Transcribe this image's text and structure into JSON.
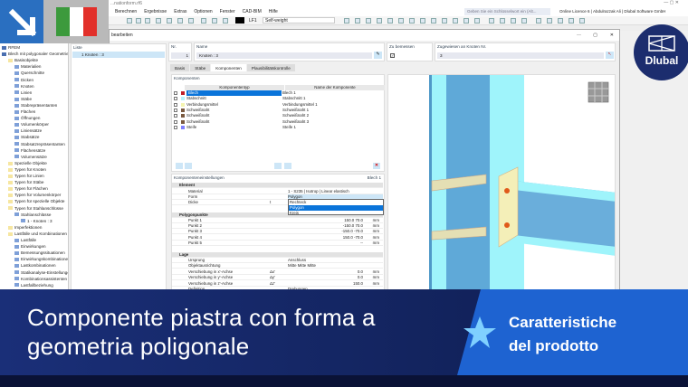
{
  "app": {
    "title_partial": "...nationform.rf6",
    "menu": [
      "Berechnen",
      "Ergebnisse",
      "Extras",
      "Optionen",
      "Fenster",
      "CAD-BIM",
      "Hilfe"
    ],
    "load_case": "LF1",
    "load_case_name": "Self-weight",
    "search_placeholder": "Geben Sie ein Schlüsselwort ein (Alt...",
    "license": "Online Licence 6 | Abdulrazzak Ali | Dlubal Software GmbH"
  },
  "dialog": {
    "title_partial": "bearbeiten",
    "liste_label": "Liste",
    "liste_item": "1  Knoten : 3",
    "nr_label": "Nr.",
    "nr_value": "1",
    "name_label": "Name",
    "name_value": "Knoten : 3",
    "design_label": "Zu bemessen",
    "assigned_label": "Zugewiesen an Knoten Nr.",
    "assigned_value": "3",
    "tabs": [
      "Basis",
      "Stäbe",
      "Komponenten",
      "Plausibilitätskontrolle"
    ],
    "components_title": "Komponenten",
    "col_type": "Komponententyp",
    "col_name": "Name der Komponente",
    "components": [
      {
        "type": "Blech",
        "name": "Blech 1",
        "color": "#c0202a"
      },
      {
        "type": "Stabschnitt",
        "name": "Stabschnitt 1",
        "color": "#b8f4ff"
      },
      {
        "type": "Verbindungsmittel",
        "name": "Verbindungsmittel 1",
        "color": "#f4f4b0"
      },
      {
        "type": "Schweißnaht",
        "name": "Schweißnaht 1",
        "color": "#7a5a40"
      },
      {
        "type": "Schweißnaht",
        "name": "Schweißnaht 2",
        "color": "#7a5a40"
      },
      {
        "type": "Schweißnaht",
        "name": "Schweißnaht 3",
        "color": "#7a5a40"
      },
      {
        "type": "Steife",
        "name": "Steife 1",
        "color": "#8080ff"
      }
    ],
    "settings_title": "Komponenteneinstellungen",
    "settings_target": "Blech 1",
    "settings": [
      {
        "k": "Element",
        "hdr": true
      },
      {
        "k": "Material",
        "v": "1 - S235 | Isotrop | Linear elastisch"
      },
      {
        "k": "Form",
        "v": "Polygon"
      },
      {
        "k": "Dicke",
        "s": "t"
      },
      {
        "k": "Polygonpunkte",
        "hdr": true
      },
      {
        "k": "Punkt 1",
        "vr": "150.0 70.0",
        "u": "mm"
      },
      {
        "k": "Punkt 2",
        "vr": "-150.0 70.0",
        "u": "mm"
      },
      {
        "k": "Punkt 3",
        "vr": "-150.0 -70.0",
        "u": "mm"
      },
      {
        "k": "Punkt 4",
        "vr": "150.0 -70.0",
        "u": "mm"
      },
      {
        "k": "Punkt 5",
        "vr": "--",
        "u": "mm"
      },
      {
        "k": "Lage",
        "hdr": true
      },
      {
        "k": "Ursprung",
        "v": "Anschluss"
      },
      {
        "k": "Objektausrichtung",
        "v": "Mitte      Mitte      Mitte"
      },
      {
        "k": "Verschiebung in x'-Achse",
        "s": "Δx'",
        "vr": "0.0",
        "u": "mm"
      },
      {
        "k": "Verschiebung in y'-Achse",
        "s": "Δy'",
        "vr": "0.0",
        "u": "mm"
      },
      {
        "k": "Verschiebung in z'-Achse",
        "s": "Δz'",
        "vr": "150.0",
        "u": "mm"
      },
      {
        "k": "Definition",
        "v": "Drehungen"
      }
    ],
    "form_options": [
      "Rechteck",
      "Polygon",
      "Kreis"
    ],
    "form_selected": "Polygon"
  },
  "navigator": [
    {
      "t": "RFEM",
      "l": 0
    },
    {
      "t": "Blech mit polygonaler Geometrie",
      "l": 0
    },
    {
      "t": "Basisobjekte",
      "l": 1,
      "f": 1
    },
    {
      "t": "Materialien",
      "l": 2
    },
    {
      "t": "Querschnitte",
      "l": 2
    },
    {
      "t": "Dicken",
      "l": 2
    },
    {
      "t": "Knoten",
      "l": 2
    },
    {
      "t": "Linien",
      "l": 2
    },
    {
      "t": "Stäbe",
      "l": 2
    },
    {
      "t": "Stabrepräsentanten",
      "l": 2
    },
    {
      "t": "Flächen",
      "l": 2
    },
    {
      "t": "Öffnungen",
      "l": 2
    },
    {
      "t": "Volumenkörper",
      "l": 2
    },
    {
      "t": "Liniensätze",
      "l": 2
    },
    {
      "t": "Stabsätze",
      "l": 2
    },
    {
      "t": "Stabsatzrepräsentanten",
      "l": 2
    },
    {
      "t": "Flächensätze",
      "l": 2
    },
    {
      "t": "Volumensätze",
      "l": 2
    },
    {
      "t": "Spezielle Objekte",
      "l": 1,
      "f": 1
    },
    {
      "t": "Typen für Knoten",
      "l": 1,
      "f": 1
    },
    {
      "t": "Typen für Linien",
      "l": 1,
      "f": 1
    },
    {
      "t": "Typen für Stäbe",
      "l": 1,
      "f": 1
    },
    {
      "t": "Typen für Flächen",
      "l": 1,
      "f": 1
    },
    {
      "t": "Typen für Volumenkörper",
      "l": 1,
      "f": 1
    },
    {
      "t": "Typen für spezielle Objekte",
      "l": 1,
      "f": 1
    },
    {
      "t": "Typen für Stahlanschlüsse",
      "l": 1,
      "f": 1
    },
    {
      "t": "Stahlanschlüsse",
      "l": 2
    },
    {
      "t": "1 - Knoten : 3",
      "l": 3
    },
    {
      "t": "Imperfektionen",
      "l": 1,
      "f": 1
    },
    {
      "t": "Lastfälle und Kombinationen",
      "l": 1,
      "f": 1
    },
    {
      "t": "Lastfälle",
      "l": 2
    },
    {
      "t": "Einwirkungen",
      "l": 2
    },
    {
      "t": "Bemessungssituationen",
      "l": 2
    },
    {
      "t": "Einwirkungskombinationen",
      "l": 2
    },
    {
      "t": "Lastkombinationen",
      "l": 2
    },
    {
      "t": "Statikanalyse-Einstellungen",
      "l": 2
    },
    {
      "t": "Kombinationsassistenten",
      "l": 2
    },
    {
      "t": "Lastfallbeziehung",
      "l": 2
    }
  ],
  "banner": {
    "headline_1": "Componente piastra con forma a",
    "headline_2": "geometria poligonale",
    "feature_1": "Caratteristiche",
    "feature_2": "del prodotto"
  },
  "logo": {
    "text": "Dlubal"
  },
  "colors": {
    "accent": "#1e63d1",
    "navy": "#1a2f78",
    "selection": "#0a74da"
  }
}
